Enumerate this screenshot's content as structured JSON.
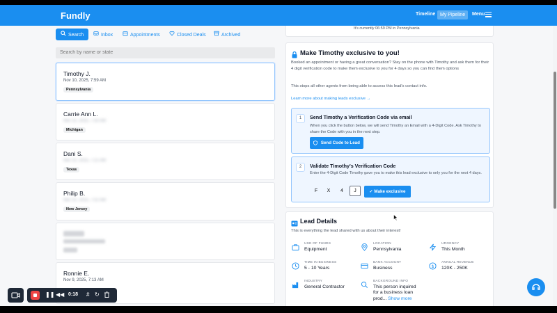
{
  "header": {
    "logo": "Fundly",
    "nav": {
      "timeline": "Timeline",
      "pipeline": "My Pipeline",
      "menu": "Menu"
    }
  },
  "tabs": [
    {
      "label": "Search",
      "icon": "search-icon"
    },
    {
      "label": "Inbox",
      "icon": "inbox-icon"
    },
    {
      "label": "Appointments",
      "icon": "calendar-icon"
    },
    {
      "label": "Closed Deals",
      "icon": "heart-icon"
    },
    {
      "label": "Archived",
      "icon": "archive-icon"
    }
  ],
  "search": {
    "placeholder": "Search by name or state"
  },
  "leads": [
    {
      "name": "Timothy J.",
      "time": "Nov 10, 2025, 7:59 AM",
      "state": "Pennsylvania"
    },
    {
      "name": "Carrie Ann L.",
      "time": "Nov 10, 2025, 7:30 AM",
      "state": "Michigan"
    },
    {
      "name": "Dani S.",
      "time": "Nov 10, 2025, 7:21 AM",
      "state": "Texas"
    },
    {
      "name": "Philip B.",
      "time": "Nov 10, 2025, 7:02 AM",
      "state": "New Jersey"
    },
    {
      "name": "Ronnie E.",
      "time": "Nov 9, 2025, 7:13 AM",
      "state": ""
    }
  ],
  "timeinfo": "It's currently 06:59 PM in Pennsylvania",
  "exclusive": {
    "title": "Make Timothy exclusive to you!",
    "p1": "Booked an appointment or having a great conversation? Stay on the phone with Timothy and ask them for their 4 digit verification code to make them exclusive to you for 4 days so you can find them options",
    "p2": "This stops all other agents from being able to access this lead's contact info.",
    "learn_more": "Learn more about making leads exclusive  →",
    "step1": {
      "num": "1",
      "title": "Send Timothy a Verification Code via email",
      "text": "When you click the button below, we will send Timothy an Email with a 4-Digit Code. Ask Timothy to share the Code with you in the next step.",
      "button": "Send Code to Lead"
    },
    "step2": {
      "num": "2",
      "title": "Validate Timothy's Verification Code",
      "text": "Enter the 4-Digit Code Timothy gave you to make this lead exclusive to only you for the next 4 days.",
      "code": [
        "F",
        "X",
        "4",
        "J"
      ],
      "button": "Make exclusive"
    }
  },
  "details": {
    "title": "Lead Details",
    "subtitle": "This is everything the lead shared with us about their interest!",
    "fields": [
      {
        "label": "USE OF FUNDS",
        "value": "Equipment",
        "icon": "briefcase-icon"
      },
      {
        "label": "LOCATION",
        "value": "Pennsylvania",
        "icon": "location-pin-icon"
      },
      {
        "label": "URGENCY",
        "value": "This Month",
        "icon": "lightning-icon"
      },
      {
        "label": "TIME IN BUSINESS",
        "value": "5 - 10 Years",
        "icon": "clock-icon"
      },
      {
        "label": "BANK ACCOUNT",
        "value": "Business",
        "icon": "credit-card-icon"
      },
      {
        "label": "ANNUAL REVENUE",
        "value": "120K - 250K",
        "icon": "dollar-icon"
      },
      {
        "label": "INDUSTRY",
        "value": "General Contractor",
        "icon": "factory-icon"
      },
      {
        "label": "BACKGROUND INFO",
        "value": "This person inquired for a business loan prod...",
        "icon": "search-icon",
        "more": "Show more"
      }
    ]
  },
  "recorder": {
    "time": "0:18"
  },
  "colors": {
    "brand": "#1a8ef0",
    "record": "#ef4444"
  }
}
